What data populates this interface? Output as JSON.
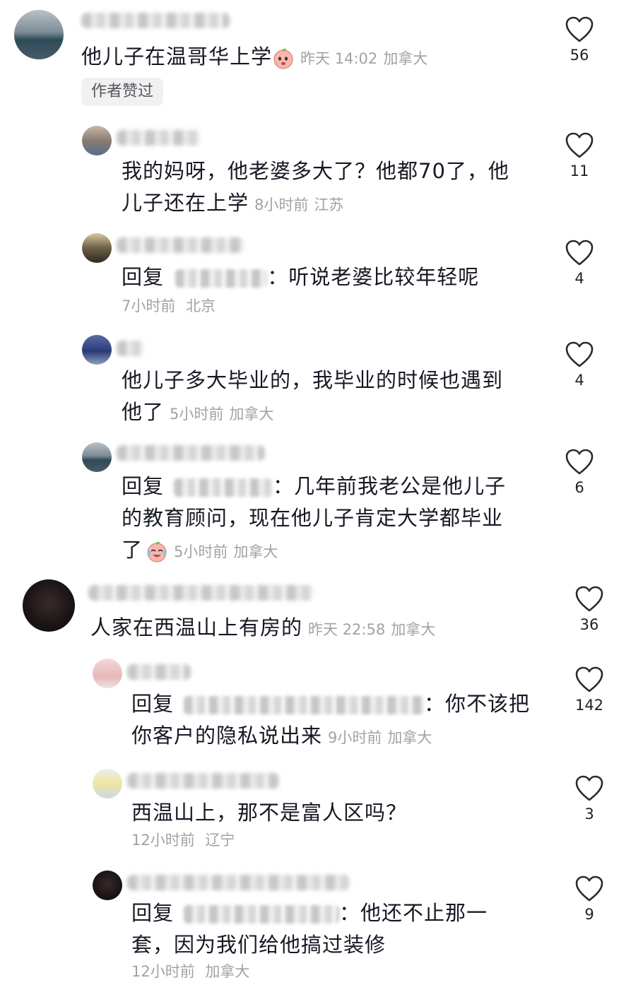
{
  "comments": [
    {
      "id": "c1",
      "text": "他儿子在温哥华上学",
      "time": "昨天 14:02",
      "location": "加拿大",
      "likes": "56",
      "author_badge": "作者赞过"
    },
    {
      "id": "c1r1",
      "line1": "我的妈呀，他老婆多大了？他都70了，他",
      "line2": "儿子还在上学",
      "time": "8小时前",
      "location": "江苏",
      "likes": "11"
    },
    {
      "id": "c1r2",
      "reply_prefix": "回复",
      "text": "：听说老婆比较年轻呢",
      "time": "7小时前",
      "location": "北京",
      "likes": "4"
    },
    {
      "id": "c1r3",
      "line1": "他儿子多大毕业的，我毕业的时候也遇到",
      "line2": "他了",
      "time": "5小时前",
      "location": "加拿大",
      "likes": "4"
    },
    {
      "id": "c1r4",
      "reply_prefix": "回复",
      "line1_rest": "：几年前我老公是他儿子",
      "line2": "的教育顾问，现在他儿子肯定大学都毕业",
      "line3": "了",
      "time": "5小时前",
      "location": "加拿大",
      "likes": "6"
    },
    {
      "id": "c2",
      "text": "人家在西温山上有房的",
      "time": "昨天 22:58",
      "location": "加拿大",
      "likes": "36"
    },
    {
      "id": "c2r1",
      "reply_prefix": "回复",
      "line1_rest": "：你不该把",
      "line2": "你客户的隐私说出来",
      "time": "9小时前",
      "location": "加拿大",
      "likes": "142"
    },
    {
      "id": "c2r2",
      "text": "西温山上，那不是富人区吗？",
      "time": "12小时前",
      "location": "辽宁",
      "likes": "3"
    },
    {
      "id": "c2r3",
      "reply_prefix": "回复",
      "line1_rest": "：他还不止那一",
      "line2": "套，因为我们给他搞过装修",
      "time": "12小时前",
      "location": "加拿大",
      "likes": "9"
    }
  ],
  "icons": {
    "like": "heart-outline-icon",
    "emoji_c1": "peach-face-emoji",
    "emoji_c1r4": "crying-laughing-peach-emoji"
  },
  "colors": {
    "text": "#161823",
    "meta": "#a1a2a7",
    "badge_bg": "#f1f1f2"
  }
}
